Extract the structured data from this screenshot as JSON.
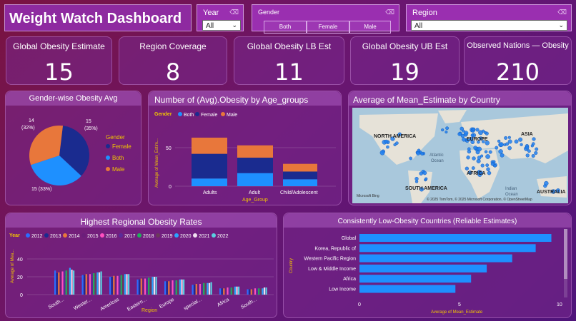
{
  "title": "Weight Watch Dashboard",
  "filters": {
    "year": {
      "label": "Year",
      "value": "All"
    },
    "gender": {
      "label": "Gender",
      "options": [
        "Both",
        "Female",
        "Male"
      ]
    },
    "region": {
      "label": "Region",
      "value": "All"
    }
  },
  "kpis": [
    {
      "label": "Global Obesity Estimate",
      "value": "15"
    },
    {
      "label": "Region Coverage",
      "value": "8"
    },
    {
      "label": "Global Obesity LB Est",
      "value": "11"
    },
    {
      "label": "Global Obesity UB Est",
      "value": "19"
    },
    {
      "label": "Observed Nations — Obesity",
      "value": "210"
    }
  ],
  "colors": {
    "both": "#1e90ff",
    "female": "#1a2b8f",
    "male": "#e8773b",
    "panel_header": "#a85ac0"
  },
  "pie": {
    "title": "Gender-wise Obesity Avg",
    "legend_title": "Gender",
    "labels": [
      {
        "line1": "15",
        "line2": "(35%)"
      },
      {
        "line1": "14",
        "line2": "(32%)"
      },
      {
        "line1": "15 (33%)",
        "line2": ""
      }
    ]
  },
  "age_chart": {
    "title": "Number of (Avg).Obesity by Age_groups",
    "legend_title": "Gender",
    "ylabel": "Average of Mean_Estim...",
    "xlabel": "Age_Group",
    "yticks": [
      "0",
      "50"
    ]
  },
  "map": {
    "title": "Average of Mean_Estimate by Country",
    "labels": {
      "na": "NORTH AMERICA",
      "eu": "EUROPE",
      "asia": "ASIA",
      "sa": "SOUTH AMERICA",
      "af": "AFRICA",
      "au": "AUSTRALIA",
      "atl": "Atlantic",
      "atl2": "Ocean",
      "ind": "Indian",
      "ind2": "Ocean"
    },
    "credit": "© 2025 TomTom, © 2025 Microsoft Corporation, © OpenStreetMap",
    "brand": "Microsoft Bing"
  },
  "region_chart": {
    "title": "Highest Regional Obesity Rates",
    "legend_title": "Year",
    "years": [
      "2012",
      "2013",
      "2014",
      "2015",
      "2016",
      "2017",
      "2018",
      "2019",
      "2020",
      "2021",
      "2022"
    ],
    "year_colors": [
      "#2b6cff",
      "#1a2b8f",
      "#e8773b",
      "#6b1e7a",
      "#ff4fbf",
      "#5a2a9a",
      "#1fb05a",
      "#6b3a5a",
      "#2aa4ff",
      "#f0e0f0",
      "#5ad0e0"
    ],
    "ylabel": "Average of Mea...",
    "xlabel": "Region",
    "yticks": [
      "0",
      "20",
      "40"
    ],
    "categories": [
      "South...",
      "Wester...",
      "Americas",
      "Eastern...",
      "Europe",
      "special...",
      "Africa",
      "South..."
    ]
  },
  "low_chart": {
    "title": "Consistently Low-Obesity Countries (Reliable Estimates)",
    "ylabel": "Country",
    "xlabel": "Average of Mean_Estimate",
    "xticks": [
      "0",
      "5",
      "10"
    ],
    "xlim": [
      0,
      10
    ]
  },
  "chart_data": [
    {
      "type": "pie",
      "categories": [
        "Female",
        "Both",
        "Male"
      ],
      "values": [
        15,
        15,
        14
      ],
      "percentages": [
        35,
        33,
        32
      ]
    },
    {
      "type": "bar",
      "stacked": true,
      "categories": [
        "Adults",
        "Adult",
        "Child/Adolescent"
      ],
      "series": [
        {
          "name": "Both",
          "values": [
            10,
            17,
            9
          ]
        },
        {
          "name": "Female",
          "values": [
            32,
            20,
            10
          ]
        },
        {
          "name": "Male",
          "values": [
            21,
            16,
            10
          ]
        }
      ],
      "ylim": [
        0,
        80
      ]
    },
    {
      "type": "bar",
      "categories": [
        "South...",
        "Wester...",
        "Americas",
        "Eastern...",
        "Europe",
        "special...",
        "Africa",
        "South..."
      ],
      "series_values": [
        [
          27,
          24,
          25,
          26,
          26,
          27,
          27,
          28,
          30,
          28,
          27
        ],
        [
          22,
          22,
          23,
          23,
          23,
          24,
          24,
          24,
          25,
          25,
          26
        ],
        [
          20,
          20,
          21,
          21,
          21,
          22,
          22,
          22,
          23,
          23,
          23
        ],
        [
          17,
          17,
          18,
          18,
          18,
          19,
          19,
          19,
          20,
          20,
          20
        ],
        [
          15,
          15,
          15,
          15,
          16,
          16,
          16,
          16,
          17,
          17,
          17
        ],
        [
          11,
          11,
          12,
          12,
          12,
          12,
          13,
          13,
          13,
          13,
          14
        ],
        [
          7,
          7,
          7,
          8,
          8,
          8,
          8,
          8,
          9,
          9,
          9
        ],
        [
          6,
          6,
          6,
          6,
          7,
          7,
          7,
          7,
          7,
          8,
          8
        ]
      ],
      "ylim": [
        0,
        45
      ]
    },
    {
      "type": "bar",
      "orientation": "horizontal",
      "categories": [
        "Global",
        "Korea, Republic of",
        "Western Pacific Region",
        "Low & Middle Income",
        "Africa",
        "Low Income"
      ],
      "values": [
        9.8,
        9.0,
        7.8,
        6.5,
        5.7,
        4.9
      ],
      "xlim": [
        0,
        10
      ]
    }
  ]
}
